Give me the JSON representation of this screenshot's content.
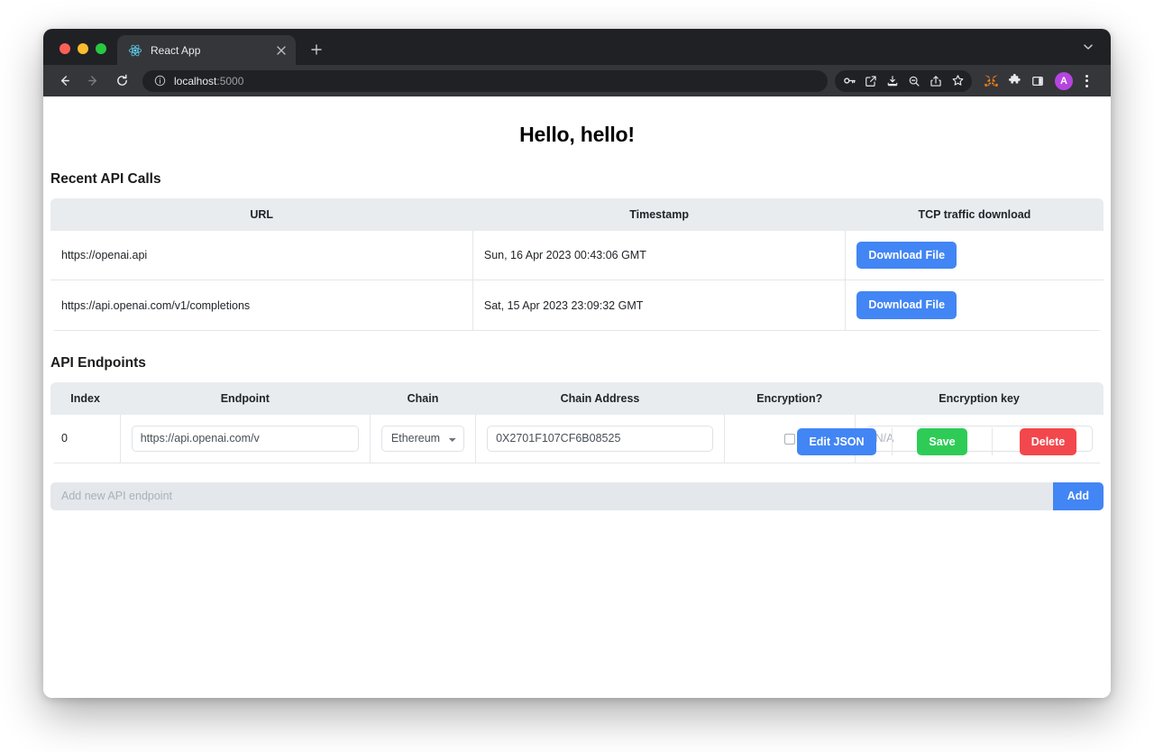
{
  "browser": {
    "tab": {
      "title": "React App",
      "favicon_icon": "react-logo-icon",
      "close_icon": "close-icon"
    },
    "new_tab_icon": "plus-icon",
    "window_chevron_icon": "chevron-down-icon",
    "nav": {
      "back_icon": "arrow-left-icon",
      "forward_icon": "arrow-right-icon",
      "reload_icon": "reload-icon"
    },
    "omnibox": {
      "info_icon": "info-circle-icon",
      "url_prefix": "localhost",
      "url_suffix": ":5000",
      "full_url": "localhost:5000"
    },
    "toolbar_icons": [
      "password-key-icon",
      "edit-square-icon",
      "install-download-icon",
      "zoom-out-icon",
      "share-icon",
      "bookmark-star-icon"
    ],
    "extension_icons": [
      "metamask-fox-icon",
      "extensions-puzzle-icon",
      "side-panel-icon"
    ],
    "avatar": {
      "initial": "A",
      "color": "#b545e0"
    },
    "menu_icon": "kebab-menu-icon"
  },
  "page": {
    "title": "Hello, hello!",
    "recent_calls": {
      "heading": "Recent API Calls",
      "columns": [
        "URL",
        "Timestamp",
        "TCP traffic download"
      ],
      "rows": [
        {
          "url": "https://openai.api",
          "timestamp": "Sun, 16 Apr 2023 00:43:06 GMT",
          "download_label": "Download File"
        },
        {
          "url": "https://api.openai.com/v1/completions",
          "timestamp": "Sat, 15 Apr 2023 23:09:32 GMT",
          "download_label": "Download File"
        }
      ]
    },
    "endpoints": {
      "heading": "API Endpoints",
      "columns": [
        "Index",
        "Endpoint",
        "Chain",
        "Chain Address",
        "Encryption?",
        "Encryption key"
      ],
      "rows": [
        {
          "index": "0",
          "endpoint_value": "https://api.openai.com/v",
          "chain_value": "Ethereum",
          "chain_options": [
            "Ethereum"
          ],
          "chain_address_value": "0X2701F107CF6B08525",
          "encryption_checked": false,
          "encryption_key_placeholder": "N/A",
          "encryption_key_value": "",
          "edit_json_label": "Edit JSON",
          "save_label": "Save",
          "delete_label": "Delete"
        }
      ],
      "add_bar": {
        "placeholder": "Add new API endpoint",
        "value": "",
        "button_label": "Add"
      }
    }
  },
  "colors": {
    "primary": "#4285f4",
    "success": "#2ecc57",
    "danger": "#f2474c",
    "table_header_bg": "#e9ecef",
    "chrome_dark": "#202124",
    "chrome_toolbar": "#35363a"
  }
}
